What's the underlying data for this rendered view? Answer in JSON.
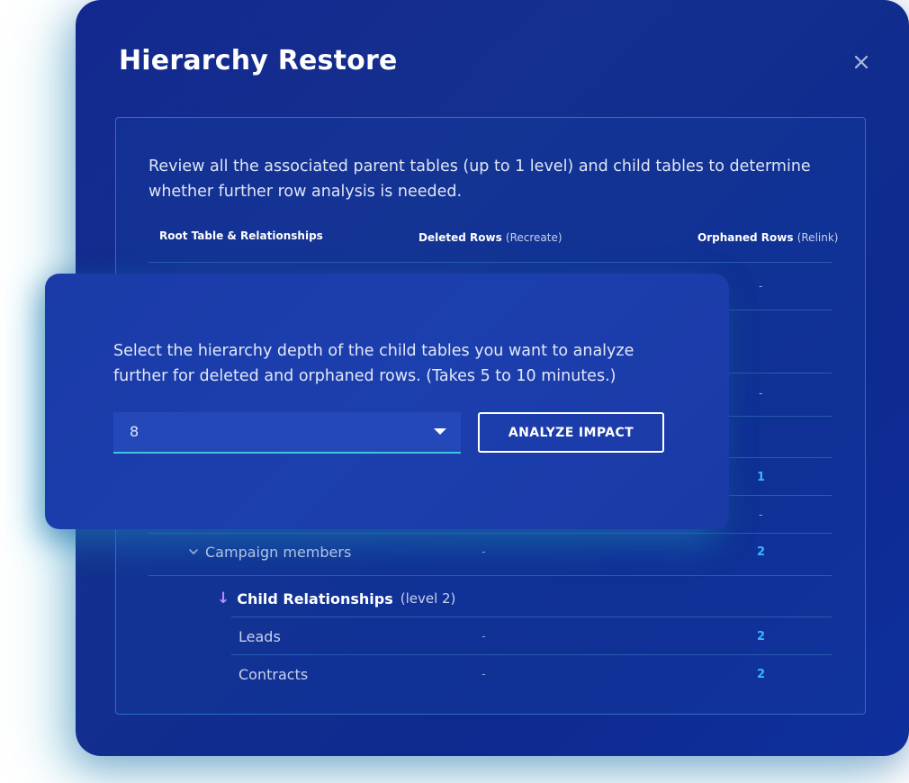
{
  "modal": {
    "title": "Hierarchy Restore",
    "description": "Review all the associated parent tables (up to 1 level) and child tables to determine whether further row analysis is needed."
  },
  "table": {
    "headers": {
      "root": "Root Table & Relationships",
      "deleted": "Deleted Rows",
      "deleted_sub": "(Recreate)",
      "orphaned": "Orphaned Rows",
      "orphaned_sub": "(Relink)"
    },
    "hidden_rows": [
      {
        "orphaned": "-"
      },
      {
        "orphaned": "-"
      },
      {
        "orphaned": "1"
      },
      {
        "orphaned": "-"
      }
    ],
    "campaign_members": {
      "label": "Campaign members",
      "deleted": "-",
      "orphaned": "2"
    },
    "child_relationships": {
      "label": "Child Relationships",
      "level": "(level 2)"
    },
    "rows": [
      {
        "label": "Leads",
        "deleted": "-",
        "orphaned": "2"
      },
      {
        "label": "Contracts",
        "deleted": "-",
        "orphaned": "2"
      }
    ]
  },
  "popup": {
    "description": "Select the hierarchy depth of the child tables you want to analyze further for deleted and orphaned rows. (Takes 5 to 10 minutes.)",
    "depth_value": "8",
    "analyze_label": "ANALYZE IMPACT"
  },
  "icons": {
    "close": "close-icon",
    "chevron": "chevron-down-icon",
    "caret": "dropdown-caret-icon",
    "arrow": "arrow-down-icon"
  },
  "colors": {
    "accent": "#38b6ff",
    "arrow": "#b98cff",
    "select_underline": "#3fc4dc"
  }
}
